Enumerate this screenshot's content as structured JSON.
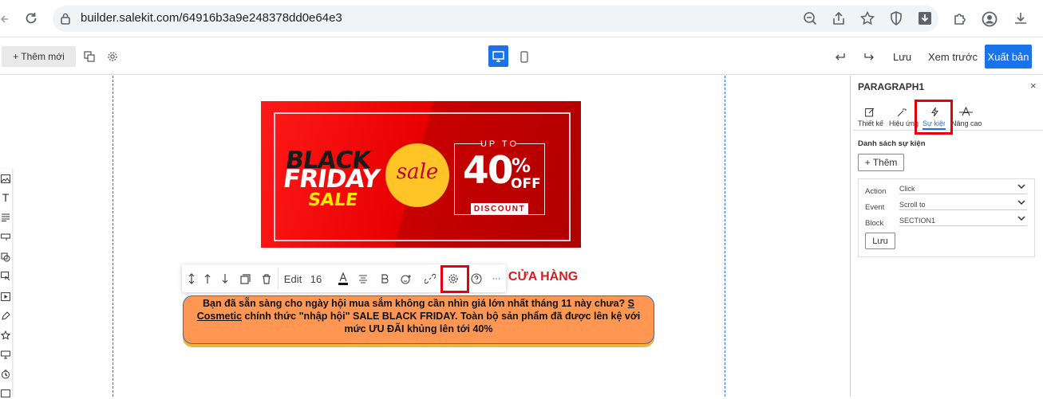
{
  "browser": {
    "url": "builder.salekit.com/64916b3a9e248378dd0e64e3"
  },
  "toolbar": {
    "add_new_label": "+ Thêm mới",
    "save_label": "Lưu",
    "preview_label": "Xem trước",
    "publish_label": "Xuất bản"
  },
  "banner": {
    "line1": "BLACK",
    "line2": "FRIDAY",
    "line3": "SALE",
    "seal": "sale",
    "up_to": "UP TO",
    "percent": "40",
    "percent_sign": "%",
    "off": "OFF",
    "discount": "DISCOUNT"
  },
  "heading": {
    "visible_text": "Ộ CỬA HÀNG"
  },
  "element_toolbar": {
    "edit_label": "Edit",
    "font_size": "16",
    "more_label": "···"
  },
  "paragraph": {
    "text_before_link": "Bạn đã sẵn sàng cho ngày hội mua sắm không cần nhìn giá lớn nhất tháng 11 này chưa? ",
    "link_text": "S Cosmetic",
    "text_after_link": " chính thức \"nhập hội\" SALE BLACK FRIDAY. Toàn bộ sản phẩm đã được lên kệ với mức ƯU ĐÃI khủng lên tới 40%"
  },
  "panel": {
    "title": "PARAGRAPH1",
    "close": "×",
    "tabs": [
      "Thiết kế",
      "Hiệu ứng",
      "Sự kiện",
      "Nâng cao"
    ],
    "active_tab": "Sự kiện",
    "event_list_label": "Danh sách sự kiện",
    "add_event_label": "+ Thêm",
    "fields": [
      {
        "label": "Action",
        "value": "Click"
      },
      {
        "label": "Event",
        "value": "Scroll to"
      },
      {
        "label": "Block",
        "value": "SECTION1"
      }
    ],
    "save_label": "Lưu"
  },
  "colors": {
    "accent": "#1a73e8",
    "highlight": "#e50010",
    "paragraph_bg": "#ff9651",
    "heading": "#d41f1f"
  }
}
